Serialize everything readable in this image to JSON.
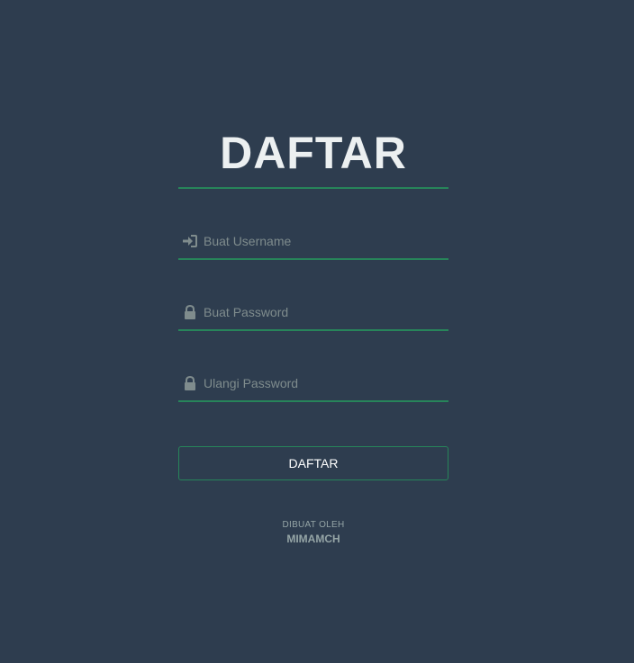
{
  "page": {
    "title": "DAFTAR",
    "accent_color": "#27855a",
    "background_color": "#2e3d4f"
  },
  "form": {
    "username": {
      "icon": "sign-in-icon",
      "placeholder": "Buat Username",
      "value": ""
    },
    "password": {
      "icon": "lock-icon",
      "placeholder": "Buat Password",
      "value": ""
    },
    "confirm_password": {
      "icon": "lock-icon",
      "placeholder": "Ulangi Password",
      "value": ""
    },
    "submit_label": "DAFTAR"
  },
  "footer": {
    "label": "DIBUAT OLEH",
    "author": "MIMAMCH"
  }
}
